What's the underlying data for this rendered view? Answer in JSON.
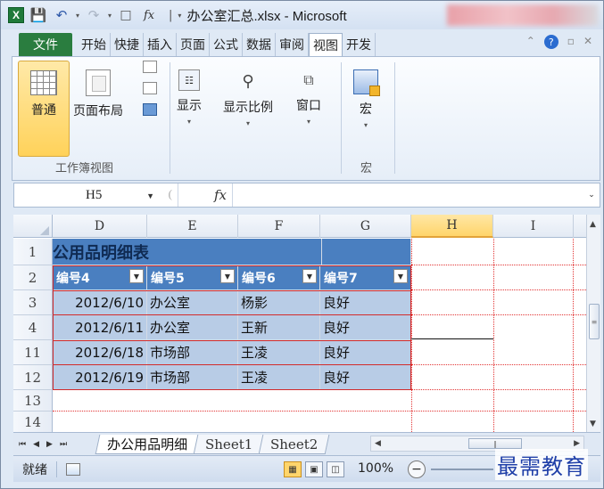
{
  "titlebar": {
    "excel_glyph": "X",
    "undo_glyph": "↶",
    "redo_glyph": "↷",
    "caret": "▾",
    "fx_glyph": "fx",
    "separator": "|",
    "title": "办公室汇总.xlsx - Microsoft"
  },
  "ribbon_tabs": {
    "file": "文件",
    "items": [
      "开始",
      "快捷",
      "插入",
      "页面",
      "公式",
      "数据",
      "审阅",
      "视图",
      "开发"
    ],
    "active": "视图",
    "help_glyph": "?"
  },
  "ribbon": {
    "normal": "普通",
    "page_layout": "页面布局",
    "group_workbook_views": "工作簿视图",
    "show": "显示",
    "zoom": "显示比例",
    "window": "窗口",
    "macro": "宏",
    "group_macro": "宏",
    "dropdown_glyph": "▾"
  },
  "formula_bar": {
    "name_box": "H5",
    "fx": "fx",
    "value": ""
  },
  "sheet": {
    "columns": [
      "D",
      "E",
      "F",
      "G",
      "H",
      "I"
    ],
    "selected_column": "H",
    "rows": [
      "1",
      "2",
      "3",
      "4",
      "11",
      "12",
      "13",
      "14"
    ],
    "title": "公用品明细表",
    "headers": [
      "编号4",
      "编号5",
      "编号6",
      "编号7"
    ],
    "data": [
      [
        "2012/6/10",
        "办公室",
        "杨影",
        "良好"
      ],
      [
        "2012/6/11",
        "办公室",
        "王新",
        "良好"
      ],
      [
        "2012/6/18",
        "市场部",
        "王凌",
        "良好"
      ],
      [
        "2012/6/19",
        "市场部",
        "王凌",
        "良好"
      ]
    ],
    "filter_glyph": "▼"
  },
  "sheet_tabs": {
    "nav": [
      "⏮",
      "◀",
      "▶",
      "⏭"
    ],
    "tabs": [
      "办公用品明细",
      "Sheet1",
      "Sheet2"
    ],
    "active": "办公用品明细"
  },
  "statusbar": {
    "ready": "就绪",
    "zoom": "100%",
    "zoom_minus": "−"
  },
  "watermark": "最需教育",
  "colors": {
    "header_blue": "#4a7fc0",
    "data_blue": "#b8cce6",
    "file_tab_green": "#2a7d3f",
    "selection_gold": "#ffd56b",
    "border_red": "#d22a2a"
  }
}
